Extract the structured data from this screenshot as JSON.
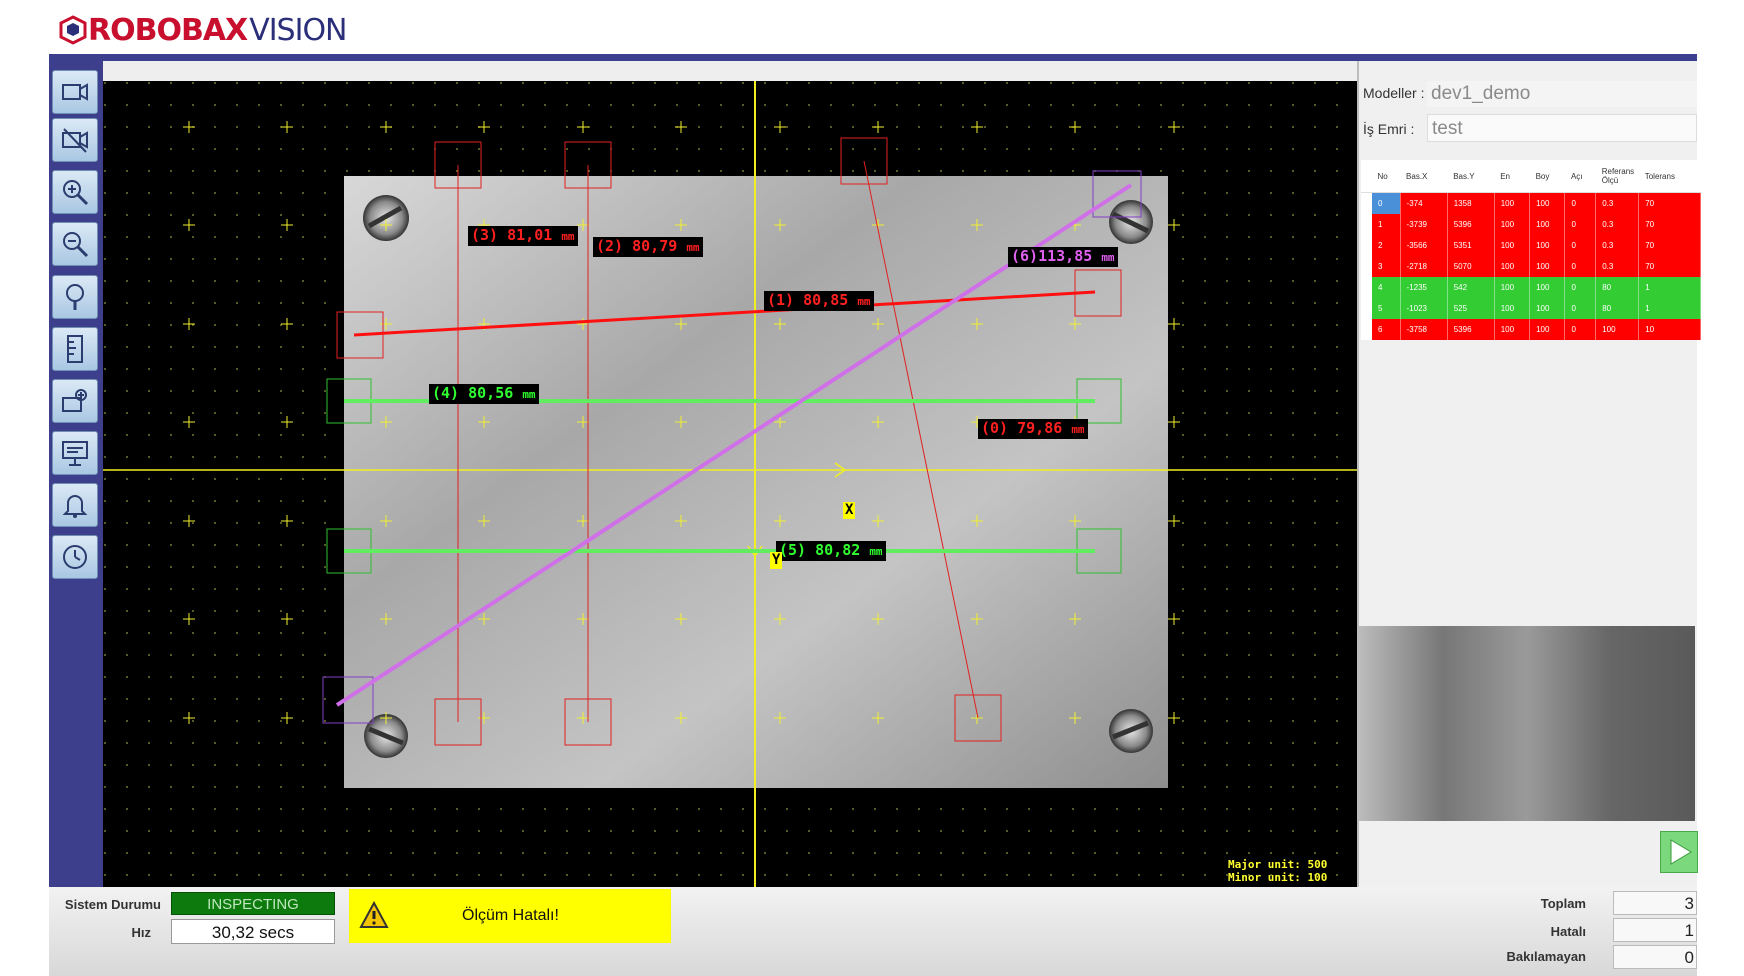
{
  "header": {
    "brand": "ROBOBAX",
    "product": "VISION"
  },
  "sidebar": {
    "buttons": [
      {
        "icon": "camera-icon"
      },
      {
        "icon": "camera-off-icon"
      },
      {
        "icon": "zoom-in-icon"
      },
      {
        "icon": "zoom-out-icon"
      },
      {
        "icon": "search-icon"
      },
      {
        "icon": "ruler-icon"
      },
      {
        "icon": "camera-settings-icon"
      },
      {
        "icon": "presentation-icon"
      },
      {
        "icon": "bell-icon"
      },
      {
        "icon": "clock-icon"
      }
    ]
  },
  "viewer": {
    "measurements": [
      {
        "text": "(3) 81,01",
        "unit": "mm",
        "color": "#ff2020"
      },
      {
        "text": "(2) 80,79",
        "unit": "mm",
        "color": "#ff2020"
      },
      {
        "text": "(6)113,85",
        "unit": "mm",
        "color": "#e060f0"
      },
      {
        "text": "(1) 80,85",
        "unit": "mm",
        "color": "#ff2020"
      },
      {
        "text": "(4) 80,56",
        "unit": "mm",
        "color": "#30ff30"
      },
      {
        "text": "(0) 79,86",
        "unit": "mm",
        "color": "#ff2020"
      },
      {
        "text": "(5) 80,82",
        "unit": "mm",
        "color": "#30ff30"
      }
    ],
    "axis_x": "X",
    "axis_y": "Y",
    "major_unit": "Major unit: 500",
    "minor_unit": "Minor unit: 100"
  },
  "right_panel": {
    "model_label": "Modeller :",
    "model_value": "dev1_demo",
    "job_label": "İş Emri :",
    "job_value": "test",
    "columns": [
      "No",
      "Bas.X",
      "Bas.Y",
      "En",
      "Boy",
      "Açı",
      "Referans Ölçü",
      "Tolerans"
    ],
    "rows": [
      {
        "cells": [
          "0",
          "-374",
          "1358",
          "100",
          "100",
          "0",
          "0.3",
          "70"
        ],
        "status": "fail"
      },
      {
        "cells": [
          "1",
          "-3739",
          "5396",
          "100",
          "100",
          "0",
          "0.3",
          "70"
        ],
        "status": "fail"
      },
      {
        "cells": [
          "2",
          "-3566",
          "5351",
          "100",
          "100",
          "0",
          "0.3",
          "70"
        ],
        "status": "fail"
      },
      {
        "cells": [
          "3",
          "-2718",
          "5070",
          "100",
          "100",
          "0",
          "0.3",
          "70"
        ],
        "status": "fail"
      },
      {
        "cells": [
          "4",
          "-1235",
          "542",
          "100",
          "100",
          "0",
          "80",
          "1"
        ],
        "status": "pass"
      },
      {
        "cells": [
          "5",
          "-1023",
          "525",
          "100",
          "100",
          "0",
          "80",
          "1"
        ],
        "status": "pass"
      },
      {
        "cells": [
          "6",
          "-3758",
          "5396",
          "100",
          "100",
          "0",
          "100",
          "10"
        ],
        "status": "fail"
      }
    ],
    "colors": {
      "fail": "#ff0000",
      "pass": "#33cc33",
      "selected": "#4a90d9"
    }
  },
  "bottom": {
    "system_label": "Sistem Durumu",
    "system_value": "INSPECTING",
    "speed_label": "Hız",
    "speed_value": "30,32 secs",
    "alert_text": "Ölçüm Hatalı!",
    "total_label": "Toplam",
    "total_value": "3",
    "faulty_label": "Hatalı",
    "faulty_value": "1",
    "unchecked_label": "Bakılamayan",
    "unchecked_value": "0"
  }
}
